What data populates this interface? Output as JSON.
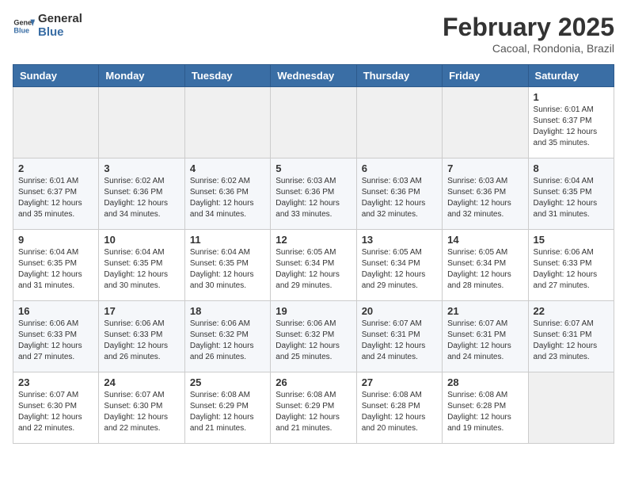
{
  "header": {
    "logo_general": "General",
    "logo_blue": "Blue",
    "month_title": "February 2025",
    "location": "Cacoal, Rondonia, Brazil"
  },
  "calendar": {
    "days_of_week": [
      "Sunday",
      "Monday",
      "Tuesday",
      "Wednesday",
      "Thursday",
      "Friday",
      "Saturday"
    ],
    "weeks": [
      [
        {
          "day": "",
          "info": ""
        },
        {
          "day": "",
          "info": ""
        },
        {
          "day": "",
          "info": ""
        },
        {
          "day": "",
          "info": ""
        },
        {
          "day": "",
          "info": ""
        },
        {
          "day": "",
          "info": ""
        },
        {
          "day": "1",
          "info": "Sunrise: 6:01 AM\nSunset: 6:37 PM\nDaylight: 12 hours and 35 minutes."
        }
      ],
      [
        {
          "day": "2",
          "info": "Sunrise: 6:01 AM\nSunset: 6:37 PM\nDaylight: 12 hours and 35 minutes."
        },
        {
          "day": "3",
          "info": "Sunrise: 6:02 AM\nSunset: 6:36 PM\nDaylight: 12 hours and 34 minutes."
        },
        {
          "day": "4",
          "info": "Sunrise: 6:02 AM\nSunset: 6:36 PM\nDaylight: 12 hours and 34 minutes."
        },
        {
          "day": "5",
          "info": "Sunrise: 6:03 AM\nSunset: 6:36 PM\nDaylight: 12 hours and 33 minutes."
        },
        {
          "day": "6",
          "info": "Sunrise: 6:03 AM\nSunset: 6:36 PM\nDaylight: 12 hours and 32 minutes."
        },
        {
          "day": "7",
          "info": "Sunrise: 6:03 AM\nSunset: 6:36 PM\nDaylight: 12 hours and 32 minutes."
        },
        {
          "day": "8",
          "info": "Sunrise: 6:04 AM\nSunset: 6:35 PM\nDaylight: 12 hours and 31 minutes."
        }
      ],
      [
        {
          "day": "9",
          "info": "Sunrise: 6:04 AM\nSunset: 6:35 PM\nDaylight: 12 hours and 31 minutes."
        },
        {
          "day": "10",
          "info": "Sunrise: 6:04 AM\nSunset: 6:35 PM\nDaylight: 12 hours and 30 minutes."
        },
        {
          "day": "11",
          "info": "Sunrise: 6:04 AM\nSunset: 6:35 PM\nDaylight: 12 hours and 30 minutes."
        },
        {
          "day": "12",
          "info": "Sunrise: 6:05 AM\nSunset: 6:34 PM\nDaylight: 12 hours and 29 minutes."
        },
        {
          "day": "13",
          "info": "Sunrise: 6:05 AM\nSunset: 6:34 PM\nDaylight: 12 hours and 29 minutes."
        },
        {
          "day": "14",
          "info": "Sunrise: 6:05 AM\nSunset: 6:34 PM\nDaylight: 12 hours and 28 minutes."
        },
        {
          "day": "15",
          "info": "Sunrise: 6:06 AM\nSunset: 6:33 PM\nDaylight: 12 hours and 27 minutes."
        }
      ],
      [
        {
          "day": "16",
          "info": "Sunrise: 6:06 AM\nSunset: 6:33 PM\nDaylight: 12 hours and 27 minutes."
        },
        {
          "day": "17",
          "info": "Sunrise: 6:06 AM\nSunset: 6:33 PM\nDaylight: 12 hours and 26 minutes."
        },
        {
          "day": "18",
          "info": "Sunrise: 6:06 AM\nSunset: 6:32 PM\nDaylight: 12 hours and 26 minutes."
        },
        {
          "day": "19",
          "info": "Sunrise: 6:06 AM\nSunset: 6:32 PM\nDaylight: 12 hours and 25 minutes."
        },
        {
          "day": "20",
          "info": "Sunrise: 6:07 AM\nSunset: 6:31 PM\nDaylight: 12 hours and 24 minutes."
        },
        {
          "day": "21",
          "info": "Sunrise: 6:07 AM\nSunset: 6:31 PM\nDaylight: 12 hours and 24 minutes."
        },
        {
          "day": "22",
          "info": "Sunrise: 6:07 AM\nSunset: 6:31 PM\nDaylight: 12 hours and 23 minutes."
        }
      ],
      [
        {
          "day": "23",
          "info": "Sunrise: 6:07 AM\nSunset: 6:30 PM\nDaylight: 12 hours and 22 minutes."
        },
        {
          "day": "24",
          "info": "Sunrise: 6:07 AM\nSunset: 6:30 PM\nDaylight: 12 hours and 22 minutes."
        },
        {
          "day": "25",
          "info": "Sunrise: 6:08 AM\nSunset: 6:29 PM\nDaylight: 12 hours and 21 minutes."
        },
        {
          "day": "26",
          "info": "Sunrise: 6:08 AM\nSunset: 6:29 PM\nDaylight: 12 hours and 21 minutes."
        },
        {
          "day": "27",
          "info": "Sunrise: 6:08 AM\nSunset: 6:28 PM\nDaylight: 12 hours and 20 minutes."
        },
        {
          "day": "28",
          "info": "Sunrise: 6:08 AM\nSunset: 6:28 PM\nDaylight: 12 hours and 19 minutes."
        },
        {
          "day": "",
          "info": ""
        }
      ]
    ]
  }
}
